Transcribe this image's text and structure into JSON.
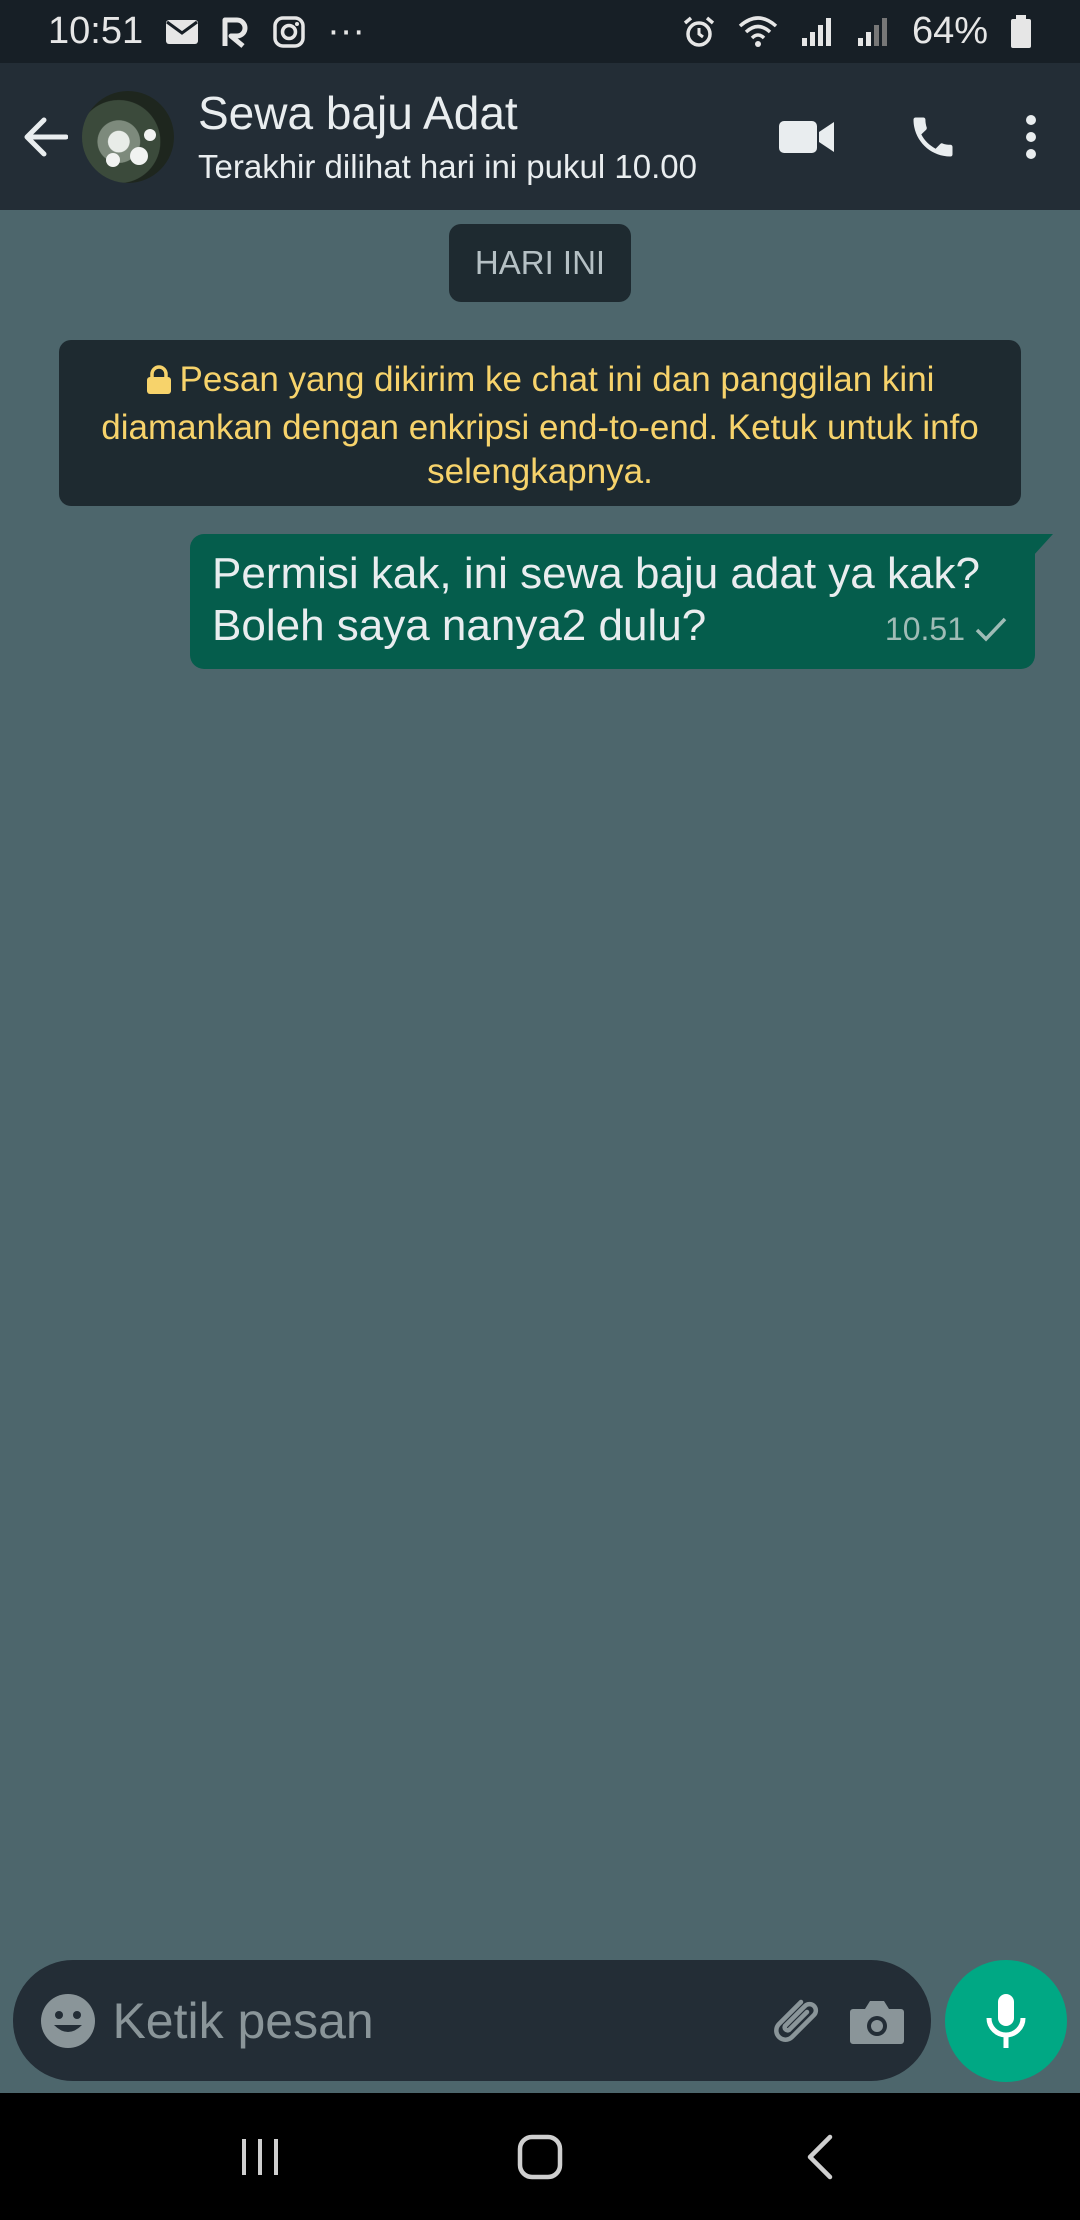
{
  "status_bar": {
    "time": "10:51",
    "battery": "64%",
    "overflow": "···",
    "icons_left": [
      "mail-icon",
      "app-icon",
      "instagram-icon"
    ],
    "icons_right": [
      "alarm-icon",
      "wifi-icon",
      "signal-icon",
      "signal-icon",
      "battery-icon"
    ]
  },
  "header": {
    "title": "Sewa baju Adat",
    "subtitle": "Terakhir dilihat hari ini pukul 10.00",
    "actions": [
      "video-call-icon",
      "phone-icon",
      "more-vert-icon"
    ]
  },
  "chat": {
    "date_chip": "HARI INI",
    "encryption_notice": "Pesan yang dikirim ke chat ini dan panggilan kini diamankan dengan enkripsi end-to-end. Ketuk untuk info selengkapnya.",
    "messages": [
      {
        "direction": "outgoing",
        "text": "Permisi kak, ini sewa baju adat ya kak? Boleh saya nanya2 dulu?",
        "time": "10.51",
        "status": "sent"
      }
    ]
  },
  "composer": {
    "placeholder": "Ketik pesan"
  },
  "colors": {
    "chat_background": "#4d666c",
    "header": "#232d36",
    "outgoing_bubble": "#055d4c",
    "accent": "#00a884",
    "notice_text": "#f7d36b"
  }
}
